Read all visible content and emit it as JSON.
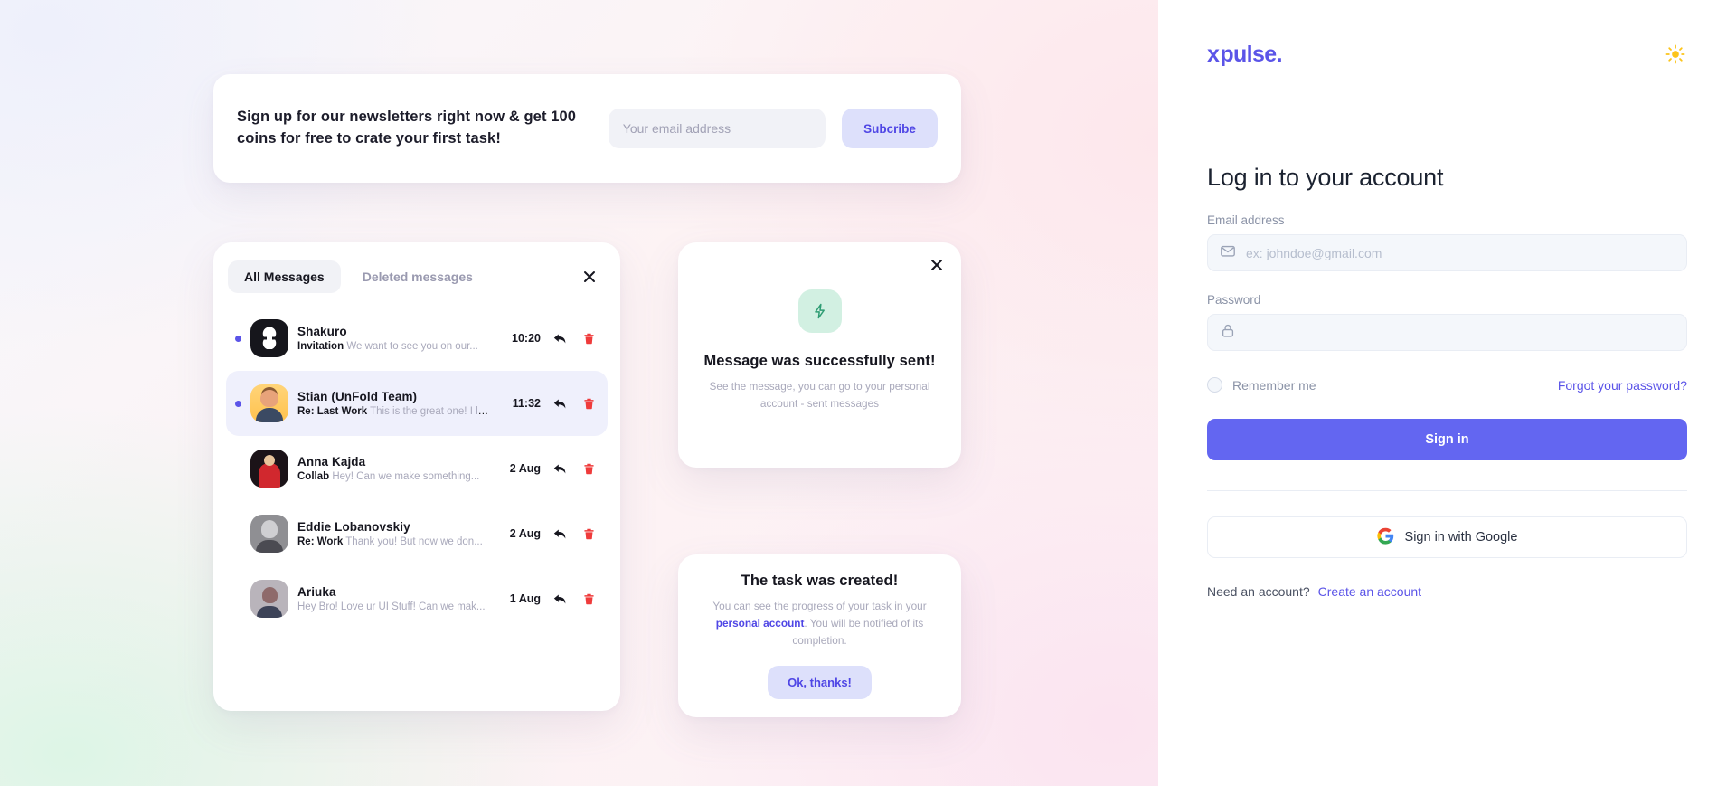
{
  "brand": {
    "logo_x": "x",
    "logo_text": "pulse.",
    "accent": "#5b54e8",
    "button_accent": "#6366f1"
  },
  "theme_toggle": {
    "icon": "sun-icon"
  },
  "login": {
    "title": "Log in to your account",
    "email_label": "Email address",
    "email_placeholder": "ex: johndoe@gmail.com",
    "email_value": "",
    "email_icon": "envelope-icon",
    "password_label": "Password",
    "password_placeholder": "",
    "password_value": "",
    "password_icon": "lock-icon",
    "remember_label": "Remember me",
    "remember_checked": false,
    "forgot_label": "Forgot your password?",
    "signin_label": "Sign in",
    "google_label": "Sign in with Google",
    "google_icon": "google-g-icon",
    "need_account_text": "Need an account?",
    "create_account_label": "Create an account"
  },
  "showcase": {
    "newsletter": {
      "headline": "Sign up for our newsletters right now & get 100 coins for free to crate your first task!",
      "input_placeholder": "Your email address",
      "input_value": "",
      "button_label": "Subcribe"
    },
    "messages_card": {
      "tabs": [
        {
          "label": "All Messages",
          "active": true
        },
        {
          "label": "Deleted messages",
          "active": false
        }
      ],
      "close_icon": "close-icon",
      "rows": [
        {
          "name": "Shakuro",
          "subject": "Invitation",
          "preview": "We want to see you on our...",
          "time": "10:20",
          "unread": true,
          "selected": false,
          "avatar": "av-shakuro",
          "reply_icon": "reply-icon",
          "delete_icon": "trash-icon"
        },
        {
          "name": "Stian (UnFold Team)",
          "subject": "Re: Last Work",
          "preview": "This is the great one! I lo...",
          "time": "11:32",
          "unread": true,
          "selected": true,
          "avatar": "av-stian",
          "reply_icon": "reply-icon",
          "delete_icon": "trash-icon"
        },
        {
          "name": "Anna Kajda",
          "subject": "Collab",
          "preview": "Hey! Can we make something...",
          "time": "2 Aug",
          "unread": false,
          "selected": false,
          "avatar": "av-anna",
          "reply_icon": "reply-icon",
          "delete_icon": "trash-icon"
        },
        {
          "name": "Eddie Lobanovskiy",
          "subject": "Re: Work",
          "preview": "Thank you! But now we don...",
          "time": "2 Aug",
          "unread": false,
          "selected": false,
          "avatar": "av-eddie",
          "reply_icon": "reply-icon",
          "delete_icon": "trash-icon"
        },
        {
          "name": "Ariuka",
          "subject": "",
          "preview": "Hey Bro! Love ur UI Stuff! Can we mak...",
          "time": "1 Aug",
          "unread": false,
          "selected": false,
          "avatar": "av-ariuka",
          "reply_icon": "reply-icon",
          "delete_icon": "trash-icon"
        }
      ]
    },
    "toast_sent": {
      "icon": "lightning-bolt-icon",
      "close_icon": "close-icon",
      "title": "Message was successfully sent!",
      "line1": "See the message, you can go to your personal",
      "line2": "account - sent messages"
    },
    "toast_created": {
      "title": "The task was created!",
      "body_before": "You can see the progress of your task in your ",
      "body_link": "personal account",
      "body_after": ". You will be notified of its completion.",
      "button_label": "Ok, thanks!"
    }
  }
}
